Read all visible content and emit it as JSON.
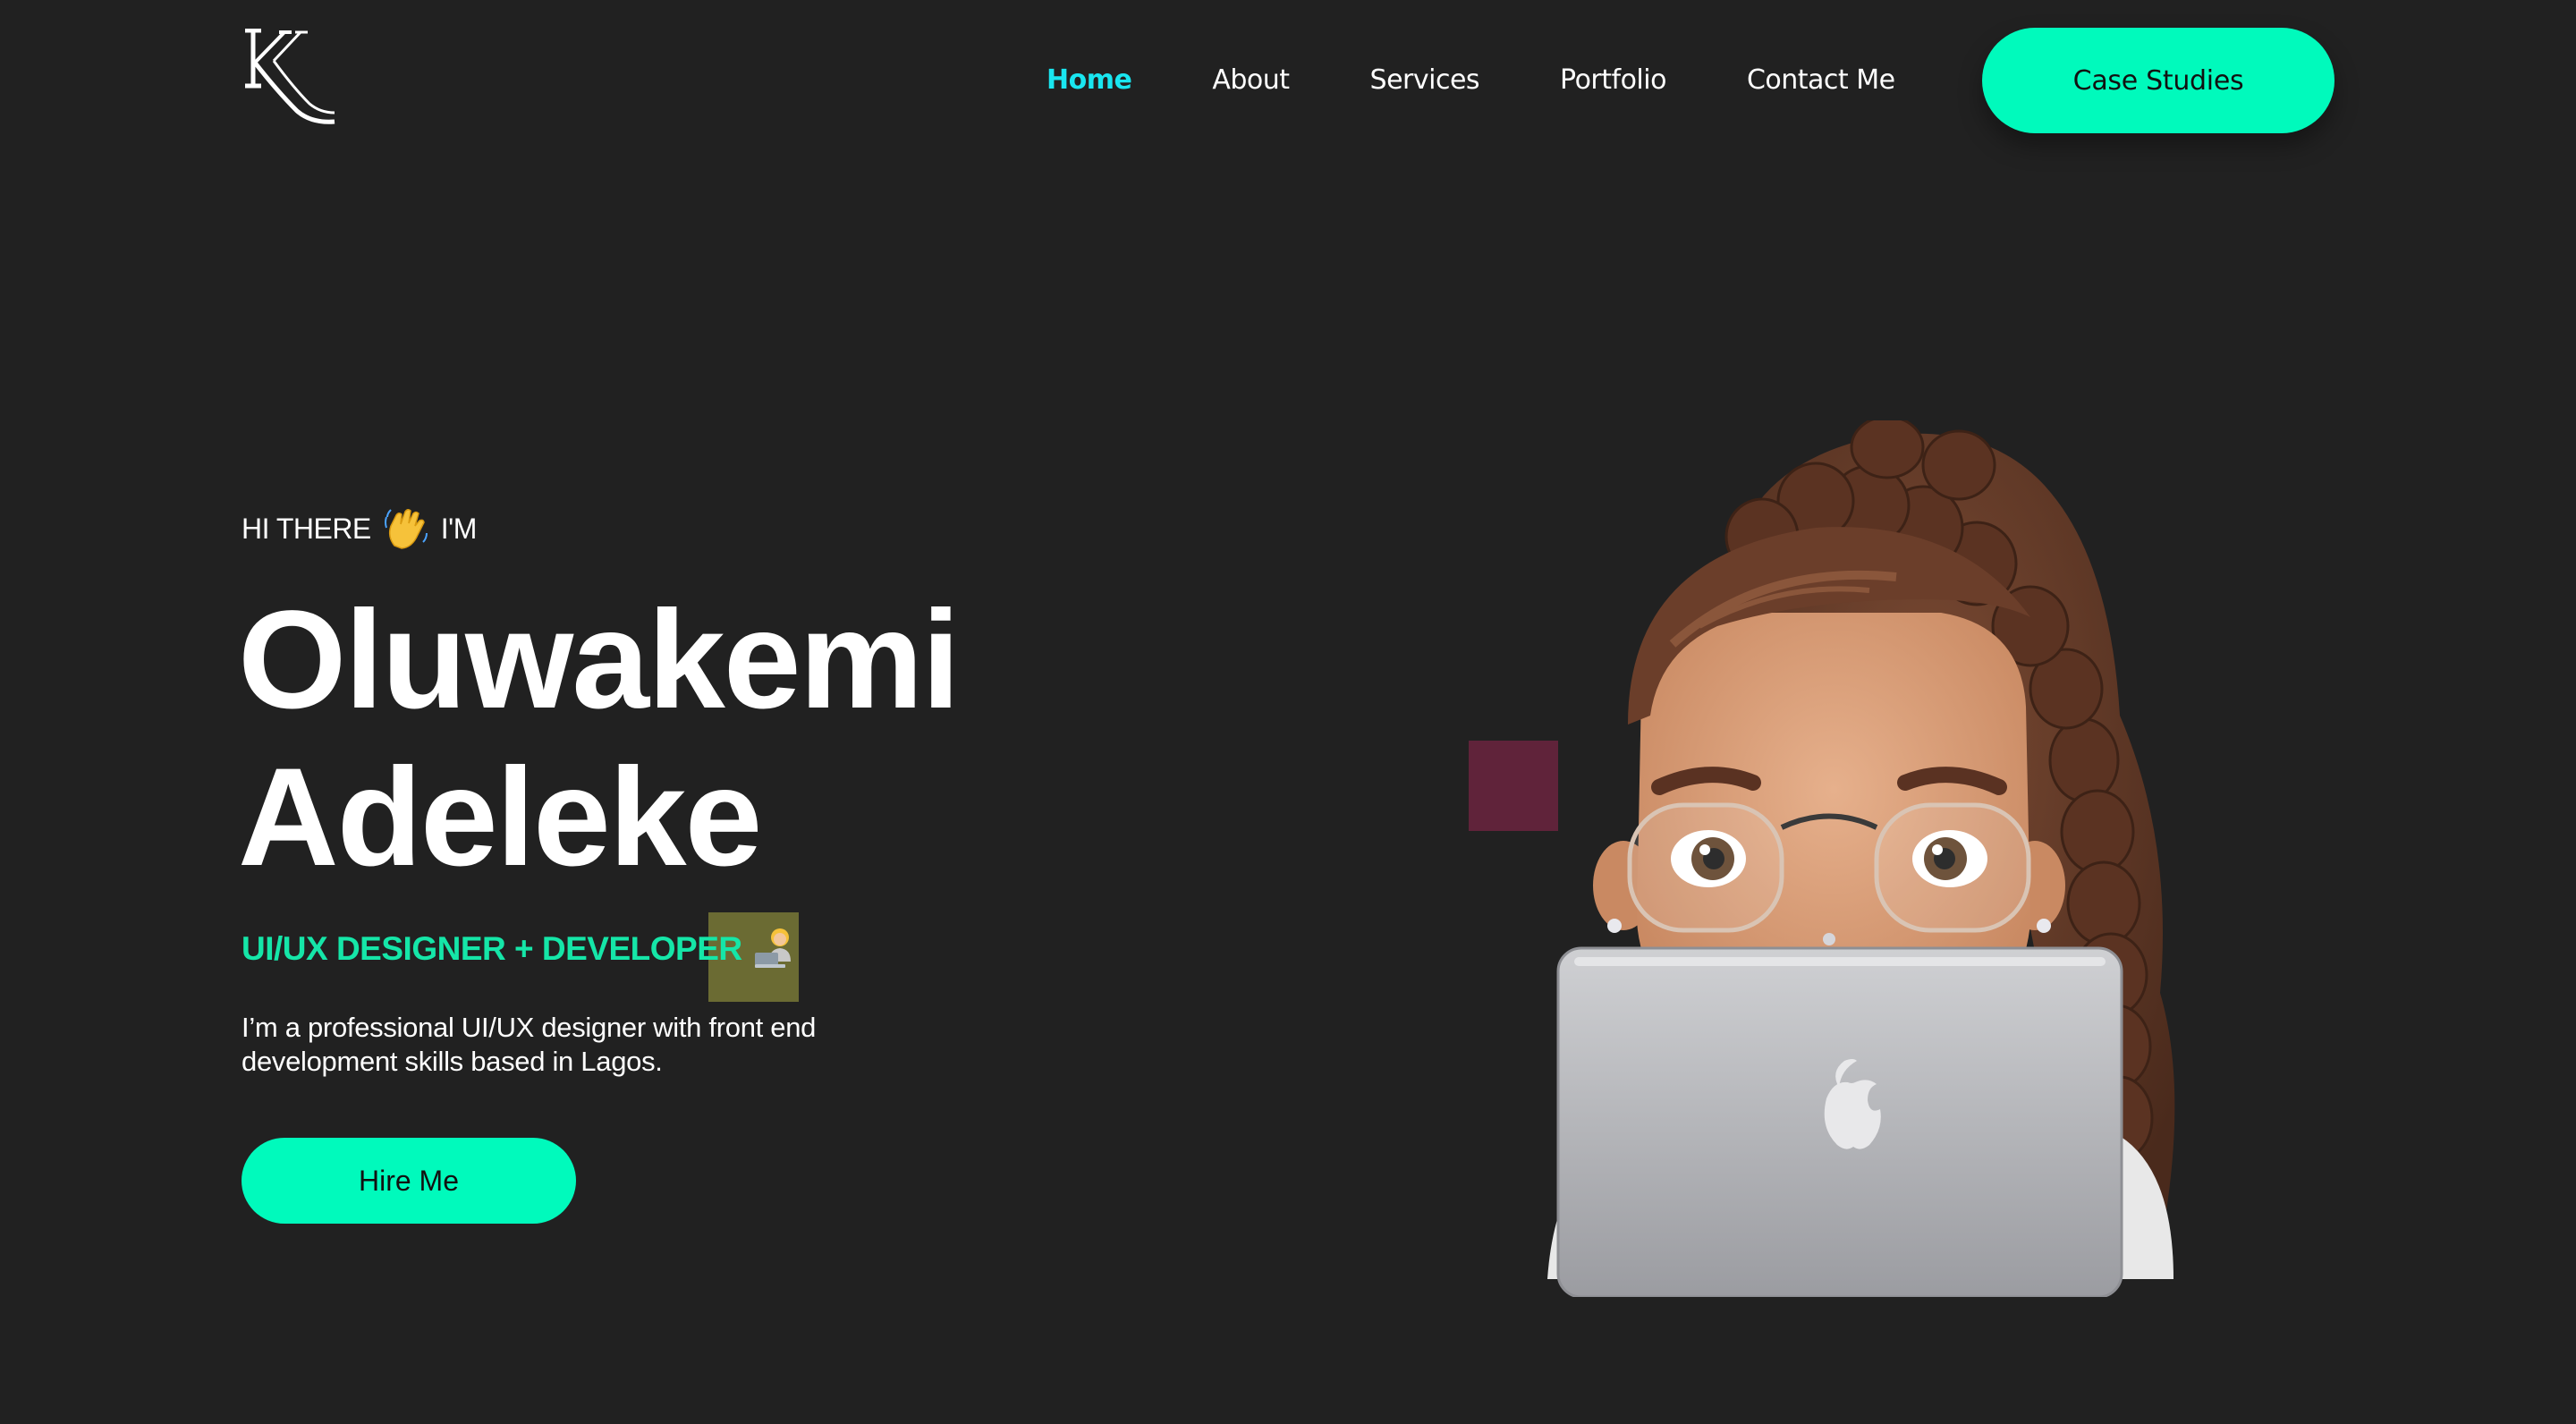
{
  "header": {
    "logo_text": "KK",
    "nav": [
      {
        "label": "Home",
        "active": true
      },
      {
        "label": "About",
        "active": false
      },
      {
        "label": "Services",
        "active": false
      },
      {
        "label": "Portfolio",
        "active": false
      },
      {
        "label": "Contact Me",
        "active": false
      }
    ],
    "cta_label": "Case Studies"
  },
  "hero": {
    "greeting_before": "HI THERE",
    "greeting_icon": "waving-hand-icon",
    "greeting_after": "I'M",
    "name_line1": "Oluwakemi",
    "name_line2": "Adeleke",
    "role": "UI/UX DESIGNER + DEVELOPER",
    "role_icon": "technologist-icon",
    "intro": "I’m a professional UI/UX designer with front end development skills based in Lagos.",
    "hire_label": "Hire Me",
    "illustration_icon": "memoji-laptop-illustration"
  },
  "colors": {
    "background": "#212121",
    "accent": "#00fabc",
    "active_nav": "#19e6f0",
    "role_text": "#15e6a8",
    "accent_square": "#60233a",
    "role_badge": "#6b6b33"
  }
}
